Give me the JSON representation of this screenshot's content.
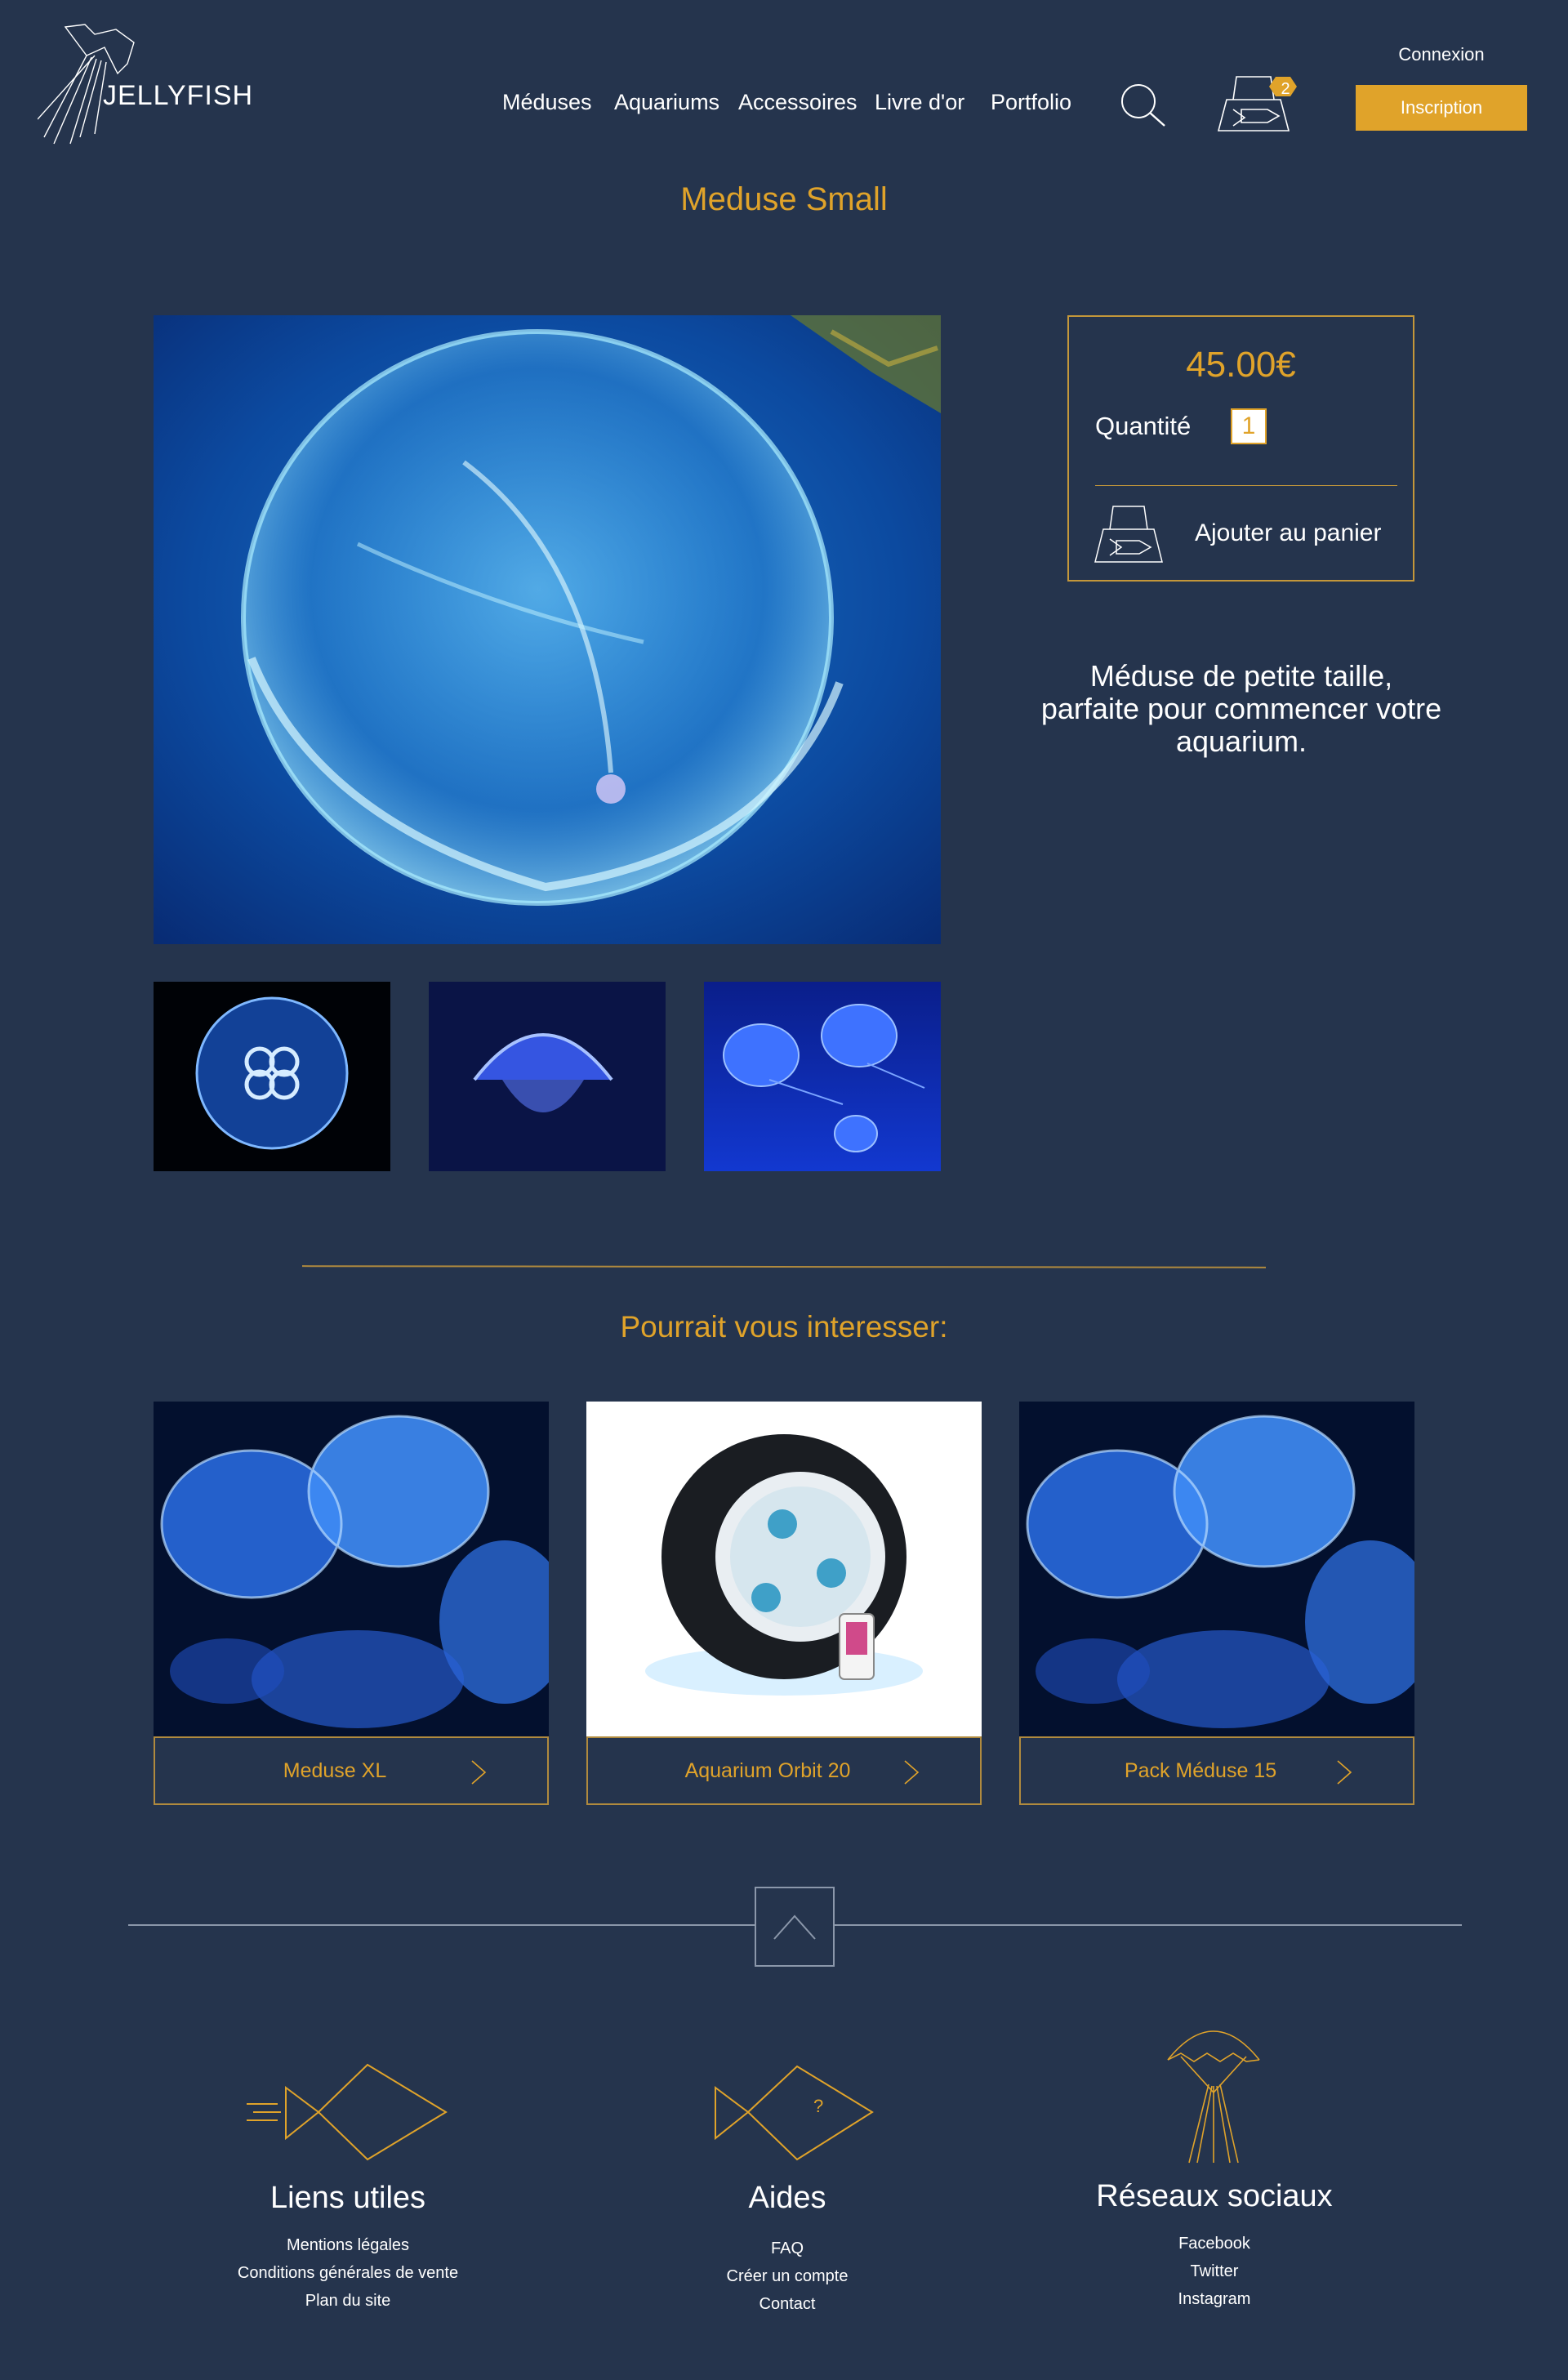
{
  "brand": {
    "name": "JELLYFISH"
  },
  "nav": {
    "items": [
      {
        "label": "Méduses"
      },
      {
        "label": "Aquariums"
      },
      {
        "label": "Accessoires"
      },
      {
        "label": "Livre d'or"
      },
      {
        "label": "Portfolio"
      }
    ]
  },
  "header": {
    "cart_count": "2",
    "connexion_label": "Connexion",
    "inscription_label": "Inscription"
  },
  "product": {
    "title": "Meduse Small",
    "price": "45.00€",
    "quantity_label": "Quantité",
    "quantity_value": "1",
    "add_to_cart_label": "Ajouter au panier",
    "description": "Méduse de petite taille, parfaite pour commencer votre aquarium."
  },
  "related": {
    "title": "Pourrait vous interesser:",
    "items": [
      {
        "label": "Meduse XL"
      },
      {
        "label": "Aquarium Orbit 20"
      },
      {
        "label": "Pack Méduse 15"
      }
    ]
  },
  "footer": {
    "columns": [
      {
        "title": "Liens utiles",
        "links": [
          "Mentions légales",
          "Conditions générales de vente",
          "Plan du site"
        ]
      },
      {
        "title": "Aides",
        "links": [
          "FAQ",
          "Créer un compte",
          "Contact"
        ]
      },
      {
        "title": "Réseaux sociaux",
        "links": [
          "Facebook",
          "Twitter",
          "Instagram"
        ]
      }
    ]
  },
  "colors": {
    "background": "#25344d",
    "accent": "#e0a32a",
    "text": "#ffffff"
  }
}
